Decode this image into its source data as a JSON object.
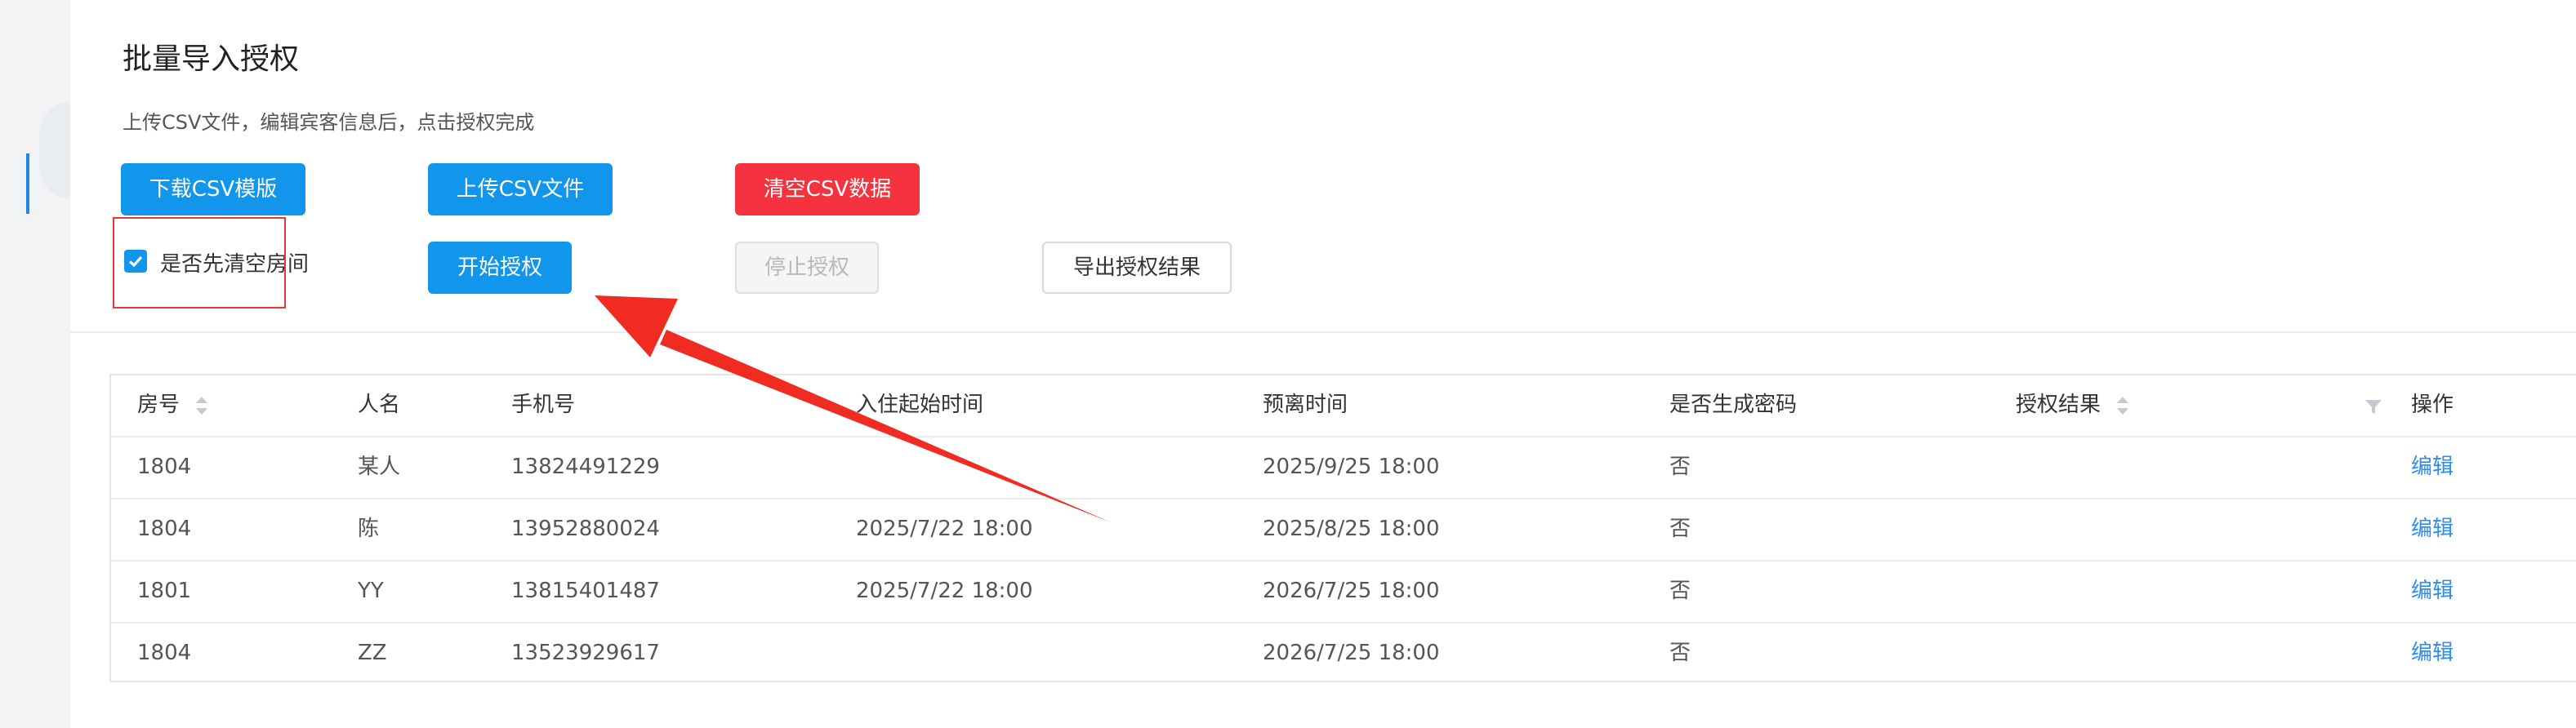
{
  "page": {
    "title": "批量导入授权",
    "subtitle": "上传CSV文件，编辑宾客信息后，点击授权完成"
  },
  "toolbar": {
    "download_template": "下载CSV模版",
    "upload_csv": "上传CSV文件",
    "clear_csv": "清空CSV数据",
    "start_auth": "开始授权",
    "stop_auth": "停止授权",
    "export_result": "导出授权结果",
    "clear_rooms_checkbox": {
      "label": "是否先清空房间",
      "checked": true
    }
  },
  "table": {
    "columns": [
      "房号",
      "人名",
      "手机号",
      "入住起始时间",
      "预离时间",
      "是否生成密码",
      "授权结果",
      "操作"
    ],
    "rows": [
      {
        "room": "1804",
        "name": "某人",
        "phone": "13824491229",
        "checkin": "",
        "checkout": "2025/9/25 18:00",
        "gen_password": "否",
        "result": "",
        "action": "编辑"
      },
      {
        "room": "1804",
        "name": "陈",
        "phone": "13952880024",
        "checkin": "2025/7/22 18:00",
        "checkout": "2025/8/25 18:00",
        "gen_password": "否",
        "result": "",
        "action": "编辑"
      },
      {
        "room": "1801",
        "name": "YY",
        "phone": "13815401487",
        "checkin": "2025/7/22 18:00",
        "checkout": "2026/7/25 18:00",
        "gen_password": "否",
        "result": "",
        "action": "编辑"
      },
      {
        "room": "1804",
        "name": "ZZ",
        "phone": "13523929617",
        "checkin": "",
        "checkout": "2026/7/25 18:00",
        "gen_password": "否",
        "result": "",
        "action": "编辑"
      }
    ]
  },
  "colors": {
    "primary": "#1296ec",
    "danger": "#f5333f",
    "annotation_red": "#e53935",
    "link": "#2d8cf0"
  },
  "icons": {
    "sort": "sort-icon",
    "filter": "filter-icon",
    "check": "check-icon"
  }
}
